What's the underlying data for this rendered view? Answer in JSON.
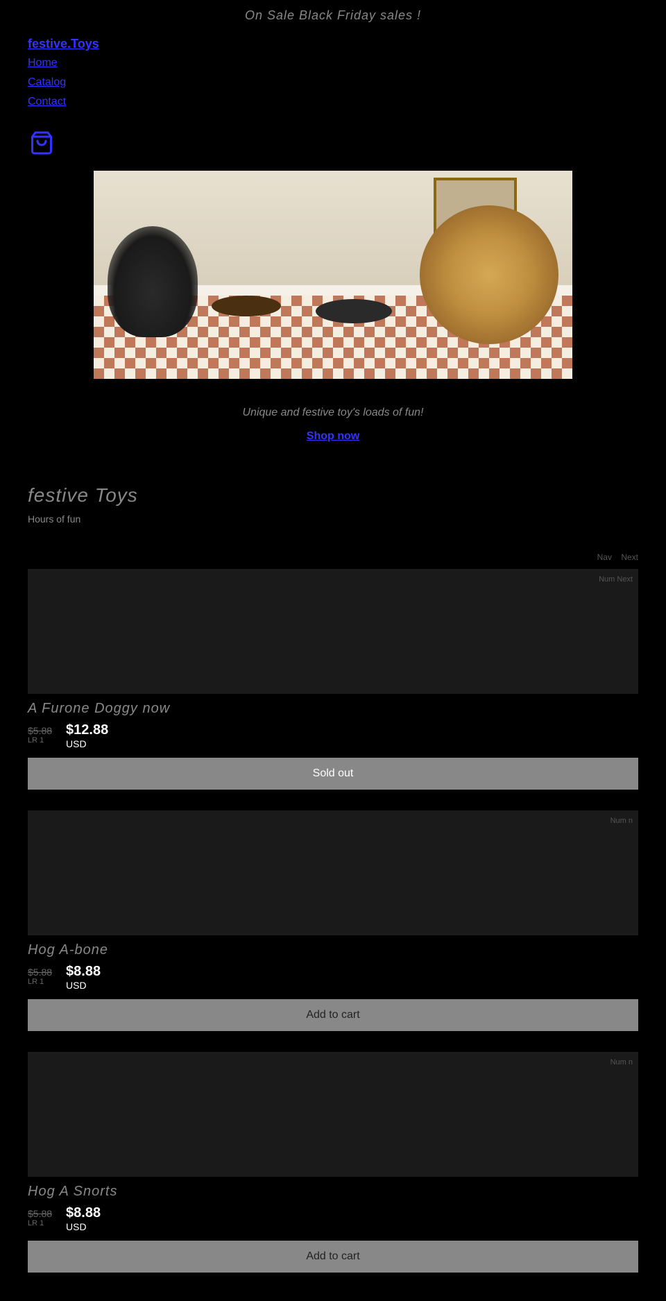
{
  "banner": {
    "text": "On Sale Black Friday sales !"
  },
  "nav": {
    "logo": "festive.Toys",
    "links": [
      "Home",
      "Catalog",
      "Contact"
    ]
  },
  "cart": {
    "icon": "shopping-bag"
  },
  "hero": {
    "alt": "Dogs at festive dinner table with food toys"
  },
  "tagline": {
    "text": "Unique and festive toy's loads of fun!",
    "shop_now": "Shop now"
  },
  "section": {
    "title": "festive Toys",
    "subtitle": "Hours of fun",
    "nav": {
      "label1": "Nav",
      "label2": "Next"
    }
  },
  "products": [
    {
      "name": "A Furone Doggy now",
      "old_price": "$5.88",
      "old_currency": "LR 1",
      "new_price": "$12.88",
      "new_currency": "USD",
      "status": "sold_out",
      "button_label": "Sold out",
      "num_label": "Num\nNext"
    },
    {
      "name": "Hog A-bone",
      "old_price": "$5.88",
      "old_currency": "LR 1",
      "new_price": "$8.88",
      "new_currency": "USD",
      "status": "available",
      "button_label": "Add to cart",
      "num_label": "Num n"
    },
    {
      "name": "Hog A Snorts",
      "old_price": "$5.88",
      "old_currency": "LR 1",
      "new_price": "$8.88",
      "new_currency": "USD",
      "status": "available",
      "button_label": "Add to cart",
      "num_label": "Num n"
    }
  ]
}
